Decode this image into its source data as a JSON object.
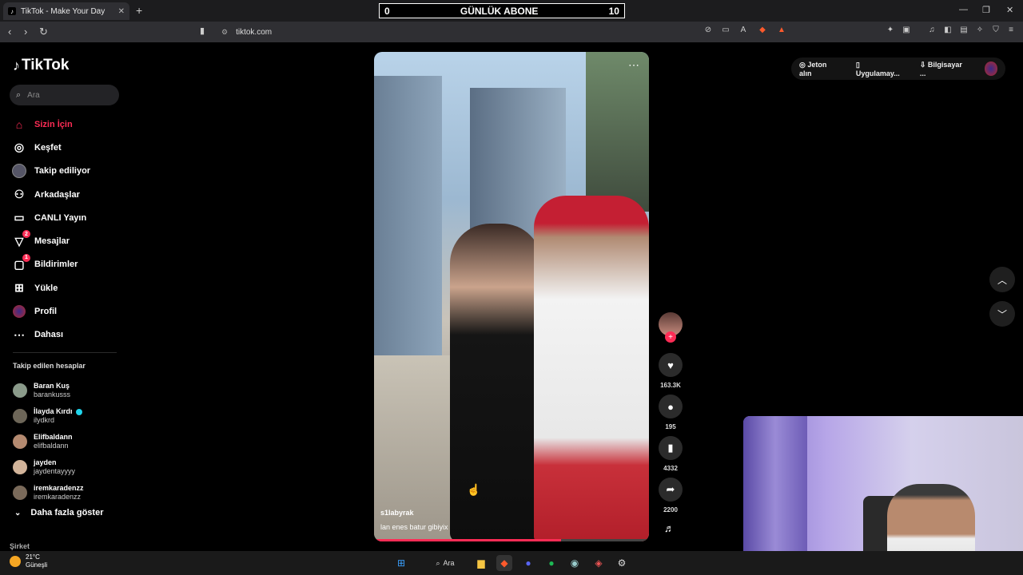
{
  "browser": {
    "tab_title": "TikTok - Make Your Day",
    "url": "tiktok.com",
    "overlay": {
      "left": "0",
      "center": "GÜNLÜK ABONE",
      "right": "10"
    }
  },
  "sidebar": {
    "logo": "TikTok",
    "search_placeholder": "Ara",
    "menu": [
      {
        "label": "Sizin İçin",
        "icon": "home-icon"
      },
      {
        "label": "Keşfet",
        "icon": "compass-icon"
      },
      {
        "label": "Takip ediliyor",
        "icon": "following-avatar-icon"
      },
      {
        "label": "Arkadaşlar",
        "icon": "friends-icon"
      },
      {
        "label": "CANLI Yayın",
        "icon": "live-icon"
      },
      {
        "label": "Mesajlar",
        "icon": "message-icon",
        "badge": "2"
      },
      {
        "label": "Bildirimler",
        "icon": "notification-icon",
        "badge": "1"
      },
      {
        "label": "Yükle",
        "icon": "upload-icon"
      },
      {
        "label": "Profil",
        "icon": "profile-icon"
      },
      {
        "label": "Dahası",
        "icon": "more-icon"
      }
    ],
    "following_header": "Takip edilen hesaplar",
    "following": [
      {
        "name": "Baran Kuş",
        "handle": "barankusss"
      },
      {
        "name": "İlayda Kırdı",
        "handle": "ilydkrd",
        "verified": true
      },
      {
        "name": "Elifbaldann",
        "handle": "elifbaldann"
      },
      {
        "name": "jayden",
        "handle": "jaydentayyyy"
      },
      {
        "name": "iremkaradenzz",
        "handle": "iremkaradenzz"
      }
    ],
    "show_more": "Daha fazla göster",
    "company": "Şirket"
  },
  "video": {
    "username": "s1labyrak",
    "description": "lan enes batur gibiyix",
    "progress_fraction": 0.68
  },
  "actions": {
    "likes": "163.3K",
    "comments": "195",
    "saves": "4332",
    "shares": "2200"
  },
  "topbar": {
    "coins": "Jeton alın",
    "app": "Uygulamay...",
    "pc": "Bilgisayar ..."
  },
  "taskbar": {
    "temp": "21°C",
    "condition": "Güneşli",
    "search": "Ara"
  },
  "colors": {
    "accent": "#fe2c55",
    "bg": "#000000"
  }
}
